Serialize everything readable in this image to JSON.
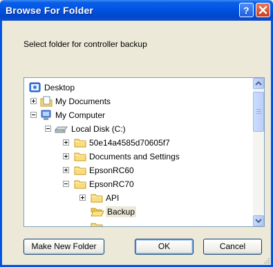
{
  "window": {
    "title": "Browse For Folder"
  },
  "dialog": {
    "instruction": "Select folder for controller backup"
  },
  "tree": {
    "nodes": [
      {
        "label": "Desktop",
        "icon": "desktop-icon",
        "expander": "none"
      },
      {
        "label": "My Documents",
        "icon": "my-documents-icon",
        "expander": "plus"
      },
      {
        "label": "My Computer",
        "icon": "my-computer-icon",
        "expander": "minus"
      },
      {
        "label": "Local Disk (C:)",
        "icon": "local-disk-icon",
        "expander": "minus"
      },
      {
        "label": "50e14a4585d70605f7",
        "icon": "folder-icon",
        "expander": "plus"
      },
      {
        "label": "Documents and Settings",
        "icon": "folder-icon",
        "expander": "plus"
      },
      {
        "label": "EpsonRC60",
        "icon": "folder-icon",
        "expander": "plus"
      },
      {
        "label": "EpsonRC70",
        "icon": "folder-icon",
        "expander": "minus"
      },
      {
        "label": "API",
        "icon": "folder-icon",
        "expander": "plus"
      },
      {
        "label": "Backup",
        "icon": "open-folder-icon",
        "expander": "none",
        "selected": true
      }
    ]
  },
  "buttons": {
    "new_folder": "Make New Folder",
    "ok": "OK",
    "cancel": "Cancel"
  },
  "colors": {
    "titlebar": "#0054e3",
    "dialog_bg": "#ece9d8",
    "tree_border": "#7f9db9"
  }
}
